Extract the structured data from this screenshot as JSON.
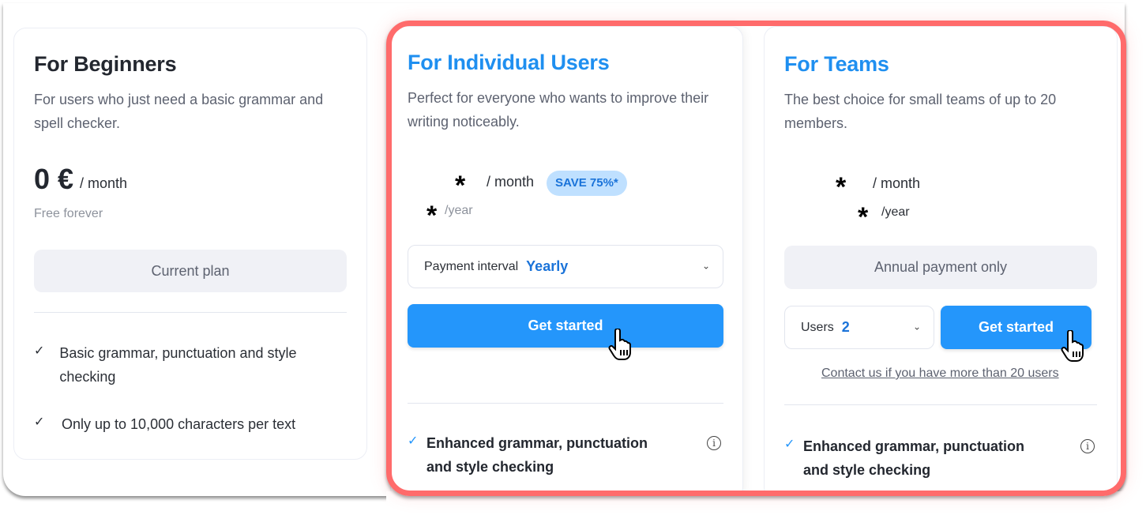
{
  "plans": {
    "beginners": {
      "title": "For Beginners",
      "description": "For users who just need a basic grammar and spell checker.",
      "price": "0 €",
      "per_month": "/ month",
      "note": "Free forever",
      "button": "Current plan",
      "features": [
        "Basic grammar, punctuation and style checking",
        "Only up to 10,000 characters per text"
      ]
    },
    "individual": {
      "title": "For Individual Users",
      "description": "Perfect for everyone who wants to improve their writing noticeably.",
      "price_monthly": "*",
      "per_month": "/ month",
      "badge": "SAVE 75%*",
      "price_yearly": "*",
      "per_year": "/year",
      "interval_label": "Payment interval",
      "interval_value": "Yearly",
      "button": "Get started",
      "features": [
        "Enhanced grammar, punctuation and style checking"
      ]
    },
    "teams": {
      "title": "For Teams",
      "description": "The best choice for small teams of up to 20 members.",
      "price_monthly": "*",
      "per_month": "/ month",
      "price_yearly": "*",
      "per_year": "/year",
      "payment_note": "Annual payment only",
      "users_label": "Users",
      "users_value": "2",
      "button": "Get started",
      "contact_link": "Contact us if you have more than 20 users",
      "features": [
        "Enhanced grammar, punctuation and style checking"
      ]
    }
  },
  "icons": {
    "check": "✓",
    "chevron": "⌄",
    "info": "i"
  },
  "colors": {
    "accent": "#2496fb",
    "highlight": "#ff6b6b",
    "badge_bg": "#bfe0ff"
  }
}
